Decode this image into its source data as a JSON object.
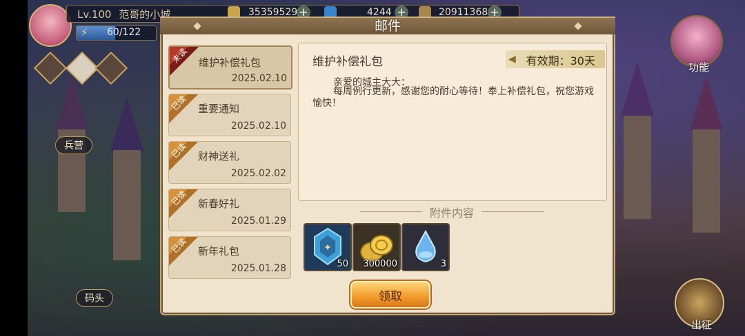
{
  "top_bar": {
    "level": "Lv.100",
    "city_name": "范哥的小城",
    "energy": "60/122",
    "energy_fraction": 0.49,
    "resources": [
      {
        "icon": "shield-coin-icon",
        "value": "35359529"
      },
      {
        "icon": "blue-crystal-icon",
        "value": "4244"
      },
      {
        "icon": "gold-leaf-icon",
        "value": "20911368"
      }
    ]
  },
  "map_labels": {
    "barracks": "兵营",
    "dock": "码头",
    "function": "功能",
    "expedition": "出征"
  },
  "panel": {
    "title": "邮件",
    "mails": [
      {
        "badge": "未读",
        "name": "维护补偿礼包",
        "date": "2025.02.10",
        "active": true
      },
      {
        "badge": "已读",
        "name": "重要通知",
        "date": "2025.02.10"
      },
      {
        "badge": "已读",
        "name": "财神送礼",
        "date": "2025.02.02"
      },
      {
        "badge": "已读",
        "name": "新春好礼",
        "date": "2025.01.29"
      },
      {
        "badge": "已读",
        "name": "新年礼包",
        "date": "2025.01.28"
      }
    ],
    "selected": {
      "title": "维护补偿礼包",
      "validity": "有效期：30天",
      "greeting": "亲爱的城主大大：",
      "body": "每周例行更新，感谢您的耐心等待！奉上补偿礼包，祝您游戏愉快！"
    },
    "attachments_title": "附件内容",
    "attachments": [
      {
        "icon": "crest-emblem-icon",
        "count": "50"
      },
      {
        "icon": "gold-coins-icon",
        "count": "300000"
      },
      {
        "icon": "blue-potion-icon",
        "count": "3"
      }
    ],
    "claim_label": "领取"
  },
  "colors": {
    "unread_ribbon": "#b8362a",
    "read_ribbon": "#d6913a",
    "claim_button": "#f29a2a"
  }
}
